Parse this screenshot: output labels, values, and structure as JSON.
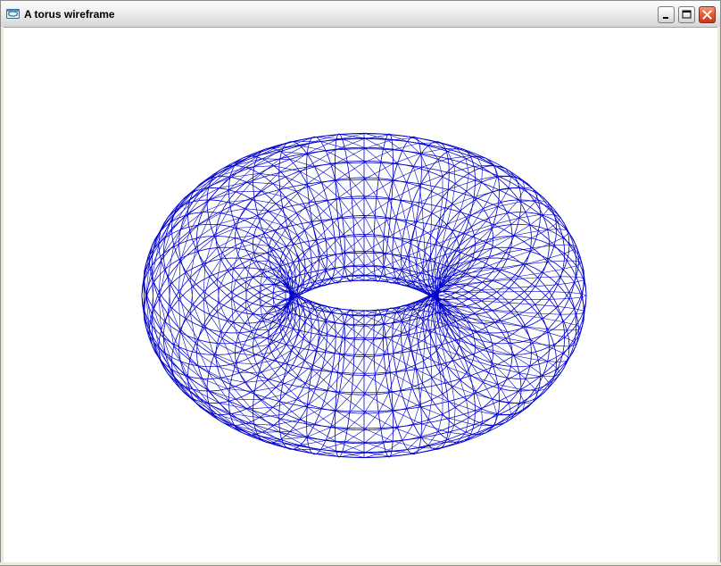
{
  "window": {
    "title": "A torus wireframe",
    "app_icon": "app-window-icon",
    "buttons": {
      "minimize_icon": "minimize-icon",
      "maximize_icon": "maximize-icon",
      "close_icon": "close-icon"
    }
  },
  "scene": {
    "object": "torus",
    "render_mode": "wireframe",
    "line_color": "#0000cc",
    "background_color": "#ffffff",
    "major_segments": 48,
    "minor_segments": 24
  }
}
